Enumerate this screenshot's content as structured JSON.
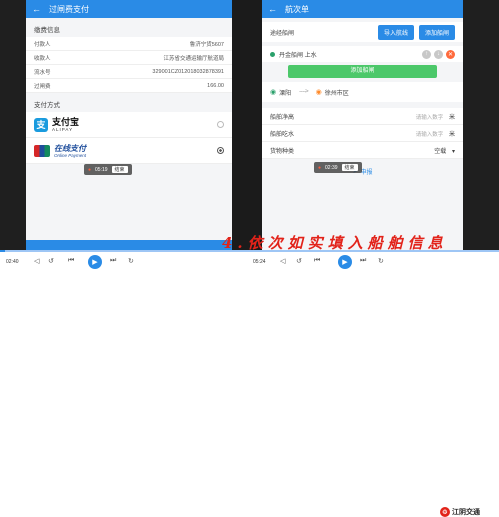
{
  "left_phone": {
    "appbar_title": "过闸费支付",
    "section_payment_info": "缴费信息",
    "rows": [
      {
        "label": "付款人",
        "value": "鲁济宁货5607"
      },
      {
        "label": "收款人",
        "value": "江苏省交通运输厅航道局"
      },
      {
        "label": "流水号",
        "value": "329001CZ012018032878391"
      },
      {
        "label": "过闸费",
        "value": "166.00"
      }
    ],
    "section_pay_method": "支付方式",
    "alipay": {
      "name": "支付宝",
      "sub": "ALIPAY"
    },
    "unionpay": {
      "name": "在线支付",
      "sub": "Online Payment"
    },
    "time_popup": {
      "time": "05:19",
      "ok": "结束"
    }
  },
  "right_phone": {
    "appbar_title": "航次单",
    "route_label": "途经船闸",
    "import_button": "导入航线",
    "add_lock_button": "添加船闸",
    "lock_item": "丹金船闸 上水",
    "add_lock_green": "添加船闸",
    "from_place": "溧阳",
    "to_place": "徐州市区",
    "fields": [
      {
        "label": "船舶净高",
        "placeholder": "请输入数字",
        "unit": "米"
      },
      {
        "label": "船舶吃水",
        "placeholder": "请输入数字",
        "unit": "米"
      }
    ],
    "cargo": {
      "label": "货物种类",
      "value": "空载"
    },
    "time_popup": {
      "time": "02:39",
      "ok": "结束"
    },
    "submit": "申报"
  },
  "player": {
    "left_time": "02:40",
    "right_time": "05:24",
    "progress": 0.01
  },
  "caption": "4.依次如实填入船舶信息",
  "brand": "江阴交通",
  "colors": {
    "primary": "#2a8be6",
    "green": "#4cc86a",
    "orange": "#ff6a3c",
    "caption_red": "#e2231a"
  }
}
